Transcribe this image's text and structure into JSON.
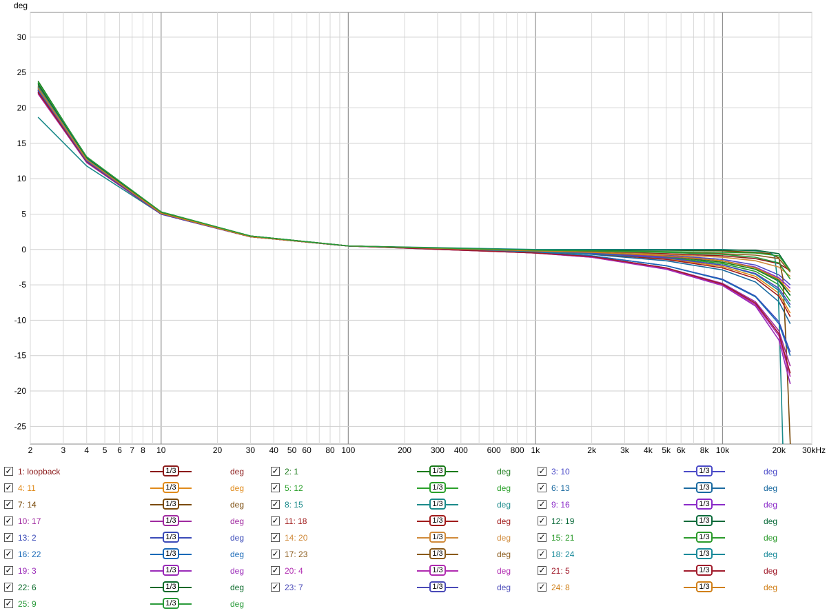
{
  "chart_data": {
    "type": "line",
    "ylabel": "deg",
    "x_scale": "log",
    "xlim": [
      2,
      30000
    ],
    "ylim": [
      -27.5,
      33.5
    ],
    "grid": true,
    "y_ticks": [
      30,
      25,
      20,
      15,
      10,
      5,
      0,
      -5,
      -10,
      -15,
      -20,
      -25
    ],
    "x_ticks": [
      {
        "v": 2,
        "l": "2"
      },
      {
        "v": 3,
        "l": "3"
      },
      {
        "v": 4,
        "l": "4"
      },
      {
        "v": 5,
        "l": "5"
      },
      {
        "v": 6,
        "l": "6"
      },
      {
        "v": 7,
        "l": "7"
      },
      {
        "v": 8,
        "l": "8"
      },
      {
        "v": 10,
        "l": "10"
      },
      {
        "v": 20,
        "l": "20"
      },
      {
        "v": 30,
        "l": "30"
      },
      {
        "v": 40,
        "l": "40"
      },
      {
        "v": 50,
        "l": "50"
      },
      {
        "v": 60,
        "l": "60"
      },
      {
        "v": 80,
        "l": "80"
      },
      {
        "v": 100,
        "l": "100"
      },
      {
        "v": 200,
        "l": "200"
      },
      {
        "v": 300,
        "l": "300"
      },
      {
        "v": 400,
        "l": "400"
      },
      {
        "v": 600,
        "l": "600"
      },
      {
        "v": 800,
        "l": "800"
      },
      {
        "v": 1000,
        "l": "1k"
      },
      {
        "v": 2000,
        "l": "2k"
      },
      {
        "v": 3000,
        "l": "3k"
      },
      {
        "v": 4000,
        "l": "4k"
      },
      {
        "v": 5000,
        "l": "5k"
      },
      {
        "v": 6000,
        "l": "6k"
      },
      {
        "v": 8000,
        "l": "8k"
      },
      {
        "v": 10000,
        "l": "10k"
      },
      {
        "v": 20000,
        "l": "20k"
      },
      {
        "v": 30000,
        "l": "30kHz"
      }
    ],
    "series": [
      {
        "name": "1: loopback",
        "color": "#8b1a1a",
        "smoothing": "1/3",
        "unit": "deg",
        "x": [
          2.2,
          4,
          10,
          30,
          100,
          1000,
          2000,
          5000,
          10000,
          15000,
          20000,
          23000
        ],
        "y": [
          22.5,
          12.5,
          5,
          1.8,
          0.5,
          -0.3,
          -0.4,
          -0.6,
          -0.9,
          -1.3,
          -2,
          -3
        ]
      },
      {
        "name": "2: 1",
        "color": "#1a7a1a",
        "smoothing": "1/3",
        "unit": "deg",
        "x": [
          2.2,
          4,
          10,
          30,
          100,
          1000,
          2000,
          5000,
          10000,
          15000,
          20000,
          23000
        ],
        "y": [
          23.8,
          13,
          5.3,
          1.9,
          0.5,
          -0.2,
          -0.5,
          -1.0,
          -1.8,
          -2.8,
          -4.5,
          -6.5
        ]
      },
      {
        "name": "3: 10",
        "color": "#4b4bc8",
        "smoothing": "1/3",
        "unit": "deg",
        "x": [
          2.2,
          4,
          10,
          30,
          100,
          1000,
          2000,
          5000,
          10000,
          15000,
          20000,
          23000
        ],
        "y": [
          22.8,
          12.6,
          5,
          1.8,
          0.5,
          -0.2,
          -0.4,
          -0.8,
          -1.4,
          -2.2,
          -3.6,
          -5
        ]
      },
      {
        "name": "4: 11",
        "color": "#e08a1a",
        "smoothing": "1/3",
        "unit": "deg",
        "x": [
          2.2,
          4,
          10,
          30,
          100,
          1000,
          2000,
          5000,
          10000,
          15000,
          20000,
          23000
        ],
        "y": [
          23,
          12.8,
          5.1,
          1.8,
          0.5,
          -0.3,
          -0.6,
          -1.3,
          -2.4,
          -3.8,
          -6.2,
          -9
        ]
      },
      {
        "name": "5: 12",
        "color": "#2aa02a",
        "smoothing": "1/3",
        "unit": "deg",
        "x": [
          2.2,
          4,
          10,
          30,
          100,
          1000,
          2000,
          5000,
          10000,
          15000,
          20000,
          23000
        ],
        "y": [
          23.5,
          13,
          5.3,
          1.9,
          0.5,
          -0.2,
          -0.5,
          -1.1,
          -2.0,
          -3.1,
          -5,
          -7.3
        ]
      },
      {
        "name": "6: 13",
        "color": "#1a6aa0",
        "smoothing": "1/3",
        "unit": "deg",
        "x": [
          2.2,
          4,
          10,
          30,
          100,
          1000,
          2000,
          5000,
          10000,
          15000,
          20000,
          23000
        ],
        "y": [
          22.6,
          12.5,
          5,
          1.8,
          0.5,
          -0.3,
          -0.7,
          -1.6,
          -2.9,
          -4.6,
          -7.4,
          -10.5
        ]
      },
      {
        "name": "7: 14",
        "color": "#7a4a0a",
        "smoothing": "1/3",
        "unit": "deg",
        "x": [
          2.2,
          4,
          10,
          30,
          100,
          1000,
          2000,
          5000,
          10000,
          15000,
          18000,
          20000,
          21000,
          22000,
          23000
        ],
        "y": [
          22.9,
          12.8,
          5.1,
          1.8,
          0.5,
          -0.1,
          -0.1,
          -0.1,
          -0.2,
          -0.4,
          -0.6,
          -1.2,
          -4,
          -15,
          -27.5
        ]
      },
      {
        "name": "8: 15",
        "color": "#1a8a8a",
        "smoothing": "1/3",
        "unit": "deg",
        "x": [
          2.2,
          4,
          10,
          30,
          100,
          1000,
          2000,
          5000,
          10000,
          15000,
          18000,
          19000,
          19800,
          20600,
          21000
        ],
        "y": [
          18.7,
          11.8,
          5,
          1.8,
          0.5,
          0,
          0,
          0,
          0,
          -0.2,
          -0.4,
          -1,
          -5,
          -20,
          -27.5
        ]
      },
      {
        "name": "9: 16",
        "color": "#8a2ac8",
        "smoothing": "1/3",
        "unit": "deg",
        "x": [
          2.2,
          4,
          10,
          30,
          100,
          1000,
          2000,
          5000,
          10000,
          15000,
          20000,
          23000
        ],
        "y": [
          22.4,
          12.4,
          5,
          1.8,
          0.5,
          -0.2,
          -0.5,
          -1.0,
          -1.6,
          -2.5,
          -4.0,
          -5.5
        ]
      },
      {
        "name": "10: 17",
        "color": "#a02aa0",
        "smoothing": "1/3",
        "unit": "deg",
        "x": [
          2.2,
          4,
          10,
          30,
          100,
          1000,
          2000,
          5000,
          10000,
          15000,
          20000,
          23000
        ],
        "y": [
          22.2,
          12.4,
          5,
          1.8,
          0.5,
          -0.4,
          -1.0,
          -2.6,
          -4.8,
          -7.4,
          -11.5,
          -16.5
        ]
      },
      {
        "name": "11: 18",
        "color": "#a01a1a",
        "smoothing": "1/3",
        "unit": "deg",
        "x": [
          2.2,
          4,
          10,
          30,
          100,
          1000,
          2000,
          5000,
          10000,
          15000,
          20000,
          23000
        ],
        "y": [
          22.3,
          12.4,
          5,
          1.8,
          0.5,
          -0.3,
          -0.6,
          -1.4,
          -2.6,
          -4.1,
          -6.6,
          -9.5
        ]
      },
      {
        "name": "12: 19",
        "color": "#0a6a3a",
        "smoothing": "1/3",
        "unit": "deg",
        "x": [
          2.2,
          4,
          10,
          30,
          100,
          1000,
          2000,
          5000,
          10000,
          15000,
          20000,
          23000
        ],
        "y": [
          23.2,
          12.9,
          5.2,
          1.9,
          0.5,
          -0.1,
          -0.1,
          -0.1,
          -0.1,
          -0.1,
          -0.6,
          -3
        ]
      },
      {
        "name": "13: 2",
        "color": "#3a4ab8",
        "smoothing": "1/3",
        "unit": "deg",
        "x": [
          2.2,
          4,
          10,
          30,
          100,
          1000,
          2000,
          5000,
          10000,
          15000,
          20000,
          23000
        ],
        "y": [
          22.7,
          12.6,
          5,
          1.8,
          0.5,
          -0.4,
          -0.9,
          -2.3,
          -4.2,
          -6.6,
          -10.2,
          -14.5
        ]
      },
      {
        "name": "14: 20",
        "color": "#d08a3a",
        "smoothing": "1/3",
        "unit": "deg",
        "x": [
          2.2,
          4,
          10,
          30,
          100,
          1000,
          2000,
          5000,
          10000,
          15000,
          20000,
          23000
        ],
        "y": [
          22.9,
          12.7,
          5.1,
          1.8,
          0.5,
          -0.2,
          -0.4,
          -0.7,
          -1.1,
          -1.6,
          -2.5,
          -3.8
        ]
      },
      {
        "name": "15: 21",
        "color": "#2a9a2a",
        "smoothing": "1/3",
        "unit": "deg",
        "x": [
          2.2,
          4,
          10,
          30,
          100,
          1000,
          2000,
          5000,
          10000,
          15000,
          20000,
          23000
        ],
        "y": [
          23.6,
          13.1,
          5.3,
          1.9,
          0.5,
          -0.1,
          -0.2,
          -0.3,
          -0.4,
          -0.5,
          -0.9,
          -3
        ]
      },
      {
        "name": "16: 22",
        "color": "#1a6ab8",
        "smoothing": "1/3",
        "unit": "deg",
        "x": [
          2.2,
          4,
          10,
          30,
          100,
          1000,
          2000,
          5000,
          10000,
          15000,
          20000,
          23000
        ],
        "y": [
          22.5,
          12.6,
          5,
          1.8,
          0.5,
          -0.4,
          -0.9,
          -2.3,
          -4.3,
          -6.7,
          -10.5,
          -15
        ]
      },
      {
        "name": "17: 23",
        "color": "#8a5a1a",
        "smoothing": "1/3",
        "unit": "deg",
        "x": [
          2.2,
          4,
          10,
          30,
          100,
          1000,
          2000,
          5000,
          10000,
          15000,
          20000,
          23000
        ],
        "y": [
          23.1,
          12.8,
          5.1,
          1.8,
          0.5,
          -0.2,
          -0.3,
          -0.4,
          -0.6,
          -0.8,
          -1.3,
          -3.2
        ]
      },
      {
        "name": "18: 24",
        "color": "#1a8a9a",
        "smoothing": "1/3",
        "unit": "deg",
        "x": [
          2.2,
          4,
          10,
          30,
          100,
          1000,
          2000,
          5000,
          10000,
          15000,
          20000,
          23000
        ],
        "y": [
          23.0,
          12.8,
          5.1,
          1.8,
          0.5,
          -0.3,
          -0.6,
          -1.2,
          -2.2,
          -3.5,
          -5.8,
          -8.2
        ]
      },
      {
        "name": "19: 3",
        "color": "#9a2ab8",
        "smoothing": "1/3",
        "unit": "deg",
        "x": [
          2.2,
          4,
          10,
          30,
          100,
          1000,
          2000,
          5000,
          10000,
          15000,
          20000,
          23000
        ],
        "y": [
          22.1,
          12.3,
          5,
          1.8,
          0.5,
          -0.5,
          -1.1,
          -2.8,
          -5.1,
          -8.0,
          -12.8,
          -19
        ]
      },
      {
        "name": "20: 4",
        "color": "#b02ab0",
        "smoothing": "1/3",
        "unit": "deg",
        "x": [
          2.2,
          4,
          10,
          30,
          100,
          1000,
          2000,
          5000,
          10000,
          15000,
          20000,
          23000
        ],
        "y": [
          22.0,
          12.3,
          5,
          1.8,
          0.5,
          -0.5,
          -1.1,
          -2.7,
          -5.0,
          -7.8,
          -12.2,
          -18
        ]
      },
      {
        "name": "21: 5",
        "color": "#a01a2a",
        "smoothing": "1/3",
        "unit": "deg",
        "x": [
          2.2,
          4,
          10,
          30,
          100,
          1000,
          2000,
          5000,
          10000,
          15000,
          20000,
          23000
        ],
        "y": [
          22.2,
          12.4,
          5,
          1.8,
          0.5,
          -0.5,
          -1.0,
          -2.6,
          -4.9,
          -7.6,
          -11.9,
          -17.5
        ]
      },
      {
        "name": "22: 6",
        "color": "#0a6a2a",
        "smoothing": "1/3",
        "unit": "deg",
        "x": [
          2.2,
          4,
          10,
          30,
          100,
          1000,
          2000,
          5000,
          10000,
          15000,
          20000,
          23000
        ],
        "y": [
          23.4,
          13,
          5.2,
          1.9,
          0.5,
          -0.2,
          -0.4,
          -0.9,
          -1.6,
          -2.6,
          -4.3,
          -6.5
        ]
      },
      {
        "name": "23: 7",
        "color": "#4a4ab8",
        "smoothing": "1/3",
        "unit": "deg",
        "x": [
          2.2,
          4,
          10,
          30,
          100,
          1000,
          2000,
          5000,
          10000,
          15000,
          20000,
          23000
        ],
        "y": [
          22.6,
          12.5,
          5,
          1.8,
          0.5,
          -0.2,
          -0.5,
          -1.2,
          -2.2,
          -3.4,
          -5.5,
          -7.8
        ]
      },
      {
        "name": "24: 8",
        "color": "#d0801a",
        "smoothing": "1/3",
        "unit": "deg",
        "x": [
          2.2,
          4,
          10,
          30,
          100,
          1000,
          2000,
          5000,
          10000,
          15000,
          20000,
          23000
        ],
        "y": [
          22.8,
          12.7,
          5.1,
          1.8,
          0.5,
          -0.2,
          -0.4,
          -0.9,
          -1.6,
          -2.6,
          -4.2,
          -6
        ]
      },
      {
        "name": "25: 9",
        "color": "#2a9a3a",
        "smoothing": "1/3",
        "unit": "deg",
        "x": [
          2.2,
          4,
          10,
          30,
          100,
          1000,
          2000,
          5000,
          10000,
          15000,
          20000,
          23000
        ],
        "y": [
          23.6,
          13.1,
          5.3,
          1.9,
          0.5,
          -0.1,
          -0.2,
          -0.4,
          -0.7,
          -1.1,
          -1.9,
          -4.2
        ]
      }
    ]
  },
  "legend": {
    "smoothing_label": "1/3",
    "check": "✓"
  }
}
